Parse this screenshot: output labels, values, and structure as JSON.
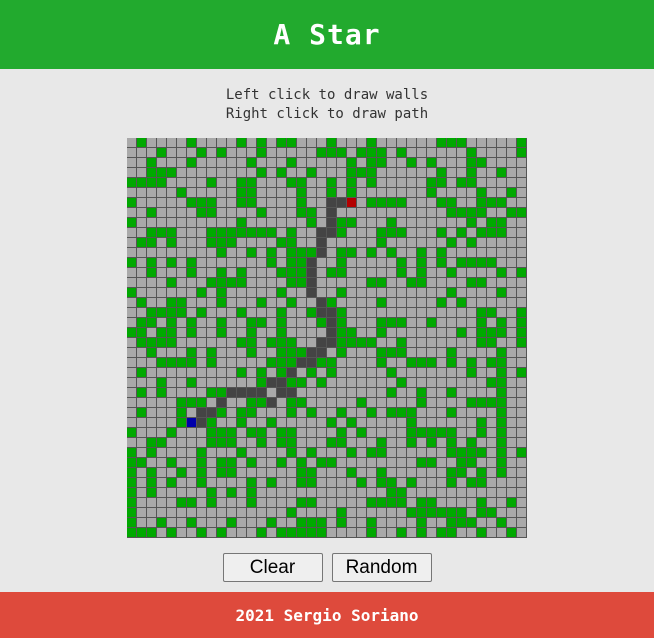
{
  "header": {
    "title": "A Star"
  },
  "instructions": {
    "line1": "Left click to draw walls",
    "line2": "Right click to draw path"
  },
  "grid": {
    "rows": 40,
    "cols": 40,
    "start": [
      28,
      6
    ],
    "end": [
      6,
      22
    ],
    "path": [
      [
        6,
        21
      ],
      [
        6,
        20
      ],
      [
        7,
        20
      ],
      [
        8,
        20
      ],
      [
        9,
        20
      ],
      [
        9,
        19
      ],
      [
        10,
        19
      ],
      [
        11,
        19
      ],
      [
        12,
        18
      ],
      [
        13,
        18
      ],
      [
        14,
        18
      ],
      [
        15,
        18
      ],
      [
        16,
        19
      ],
      [
        17,
        20
      ],
      [
        17,
        19
      ],
      [
        18,
        20
      ],
      [
        19,
        20
      ],
      [
        20,
        19
      ],
      [
        21,
        18
      ],
      [
        22,
        17
      ],
      [
        23,
        16
      ],
      [
        24,
        15
      ],
      [
        24,
        14
      ],
      [
        25,
        13
      ],
      [
        25,
        12
      ],
      [
        25,
        11
      ],
      [
        25,
        10
      ],
      [
        26,
        9
      ],
      [
        27,
        8
      ],
      [
        27,
        7
      ],
      [
        28,
        7
      ],
      [
        28,
        6
      ],
      [
        26,
        14
      ],
      [
        25,
        15
      ],
      [
        25,
        16
      ],
      [
        21,
        19
      ],
      [
        22,
        18
      ],
      [
        20,
        20
      ]
    ],
    "colors": {
      "wall": "#00a800",
      "empty": "#a9a9a9",
      "path": "#444444",
      "start": "#0000aa",
      "end": "#b30000"
    }
  },
  "controls": {
    "clear_label": "Clear",
    "random_label": "Random"
  },
  "footer": {
    "text": "2021 Sergio Soriano"
  }
}
